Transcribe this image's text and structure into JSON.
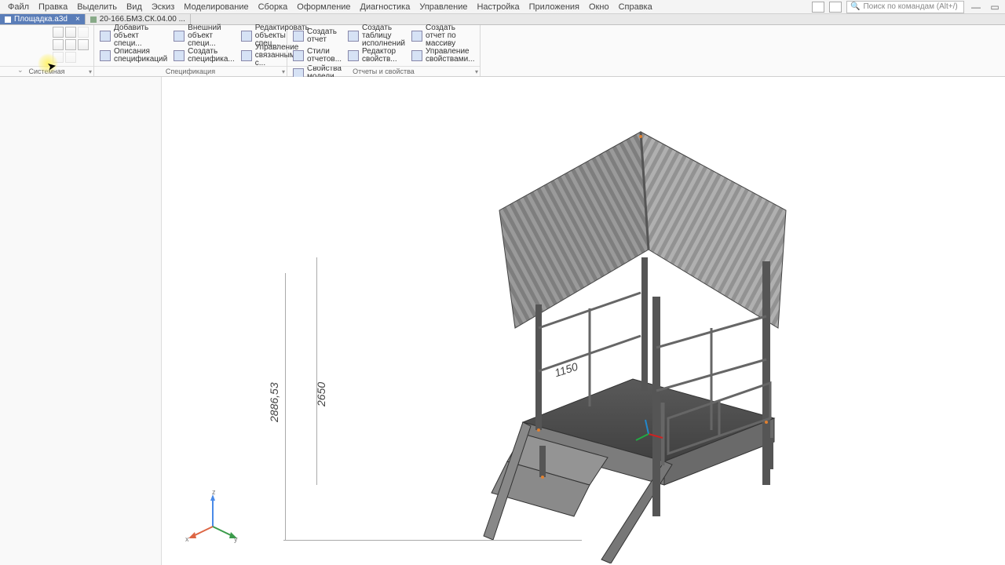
{
  "menu": {
    "items": [
      "Файл",
      "Правка",
      "Выделить",
      "Вид",
      "Эскиз",
      "Моделирование",
      "Сборка",
      "Оформление",
      "Диагностика",
      "Управление",
      "Настройка",
      "Приложения",
      "Окно",
      "Справка"
    ],
    "search_placeholder": "Поиск по командам (Alt+/)"
  },
  "tabs": {
    "active": "Площадка.a3d",
    "inactive": "20-166.БМ3.СК.04.00 ..."
  },
  "ribbon": {
    "group_system": "Системная",
    "group_spec": "Спецификация",
    "group_reports": "Отчеты и свойства",
    "spec_buttons": {
      "add_obj": "Добавить объект специ...",
      "ext_obj": "Внешний объект специ...",
      "edit_objs": "Редактировать объекты спец...",
      "desc_spec": "Описания спецификаций",
      "create_spec": "Создать специфика...",
      "manage_linked": "Управление связанными с..."
    },
    "report_buttons": {
      "create_report": "Создать отчет",
      "create_table": "Создать таблицу исполнений",
      "create_array": "Создать отчет по массиву",
      "report_styles": "Стили отчетов...",
      "prop_editor": "Редактор свойств...",
      "prop_manage": "Управление свойствами...",
      "model_props": "Свойства модели"
    }
  },
  "dimensions": {
    "height_total": "2886,53",
    "height_sub": "2650",
    "width": "1150"
  },
  "triad": {
    "x": "x",
    "y": "y",
    "z": "z"
  }
}
